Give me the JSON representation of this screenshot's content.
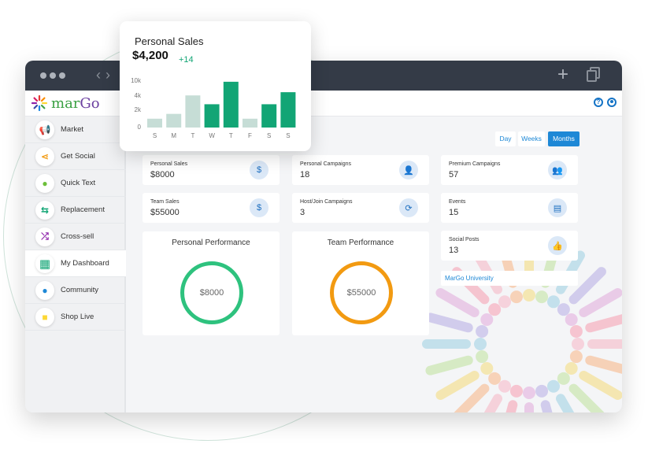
{
  "sales_card": {
    "title": "Personal Sales",
    "value": "$4,200",
    "delta": "+14",
    "chart_data": {
      "type": "bar",
      "categories": [
        "S",
        "M",
        "T",
        "W",
        "T",
        "F",
        "S",
        "S"
      ],
      "values": [
        1.1,
        1.7,
        4.0,
        2.9,
        5.7,
        1.1,
        2.9,
        4.4
      ],
      "yticks": [
        "0",
        "2k",
        "4k",
        "10k"
      ],
      "colors": [
        "#c6ddd6",
        "#c6ddd6",
        "#c6ddd6",
        "#12a575",
        "#12a575",
        "#c6ddd6",
        "#12a575",
        "#12a575"
      ]
    }
  },
  "brand": {
    "name_a": "mar",
    "name_b": "Go"
  },
  "header": {
    "help": "?"
  },
  "sidebar": {
    "items": [
      {
        "label": "Market",
        "icon": "megaphone-icon",
        "glyph": "📢",
        "active": false
      },
      {
        "label": "Get Social",
        "icon": "share-icon",
        "glyph": "⋖",
        "active": false
      },
      {
        "label": "Quick Text",
        "icon": "chat-icon",
        "glyph": "💬",
        "active": false
      },
      {
        "label": "Replacement",
        "icon": "swap-arrows-icon",
        "glyph": "⇆",
        "active": false
      },
      {
        "label": "Cross-sell",
        "icon": "shuffle-icon",
        "glyph": "⤮",
        "active": false
      },
      {
        "label": "My Dashboard",
        "icon": "dashboard-grid-icon",
        "glyph": "▦",
        "active": true
      },
      {
        "label": "Community",
        "icon": "community-chat-icon",
        "glyph": "💬",
        "active": false
      },
      {
        "label": "Shop Live",
        "icon": "shop-icon",
        "glyph": "🛍",
        "active": false
      }
    ]
  },
  "period": {
    "day": "Day",
    "weeks": "Weeks",
    "months": "Months",
    "selected": "Months"
  },
  "stats": {
    "personal_sales": {
      "label": "Personal Sales",
      "value": "$8000"
    },
    "personal_campaigns": {
      "label": "Personal Campaigns",
      "value": "18"
    },
    "premium_campaigns": {
      "label": "Premium Campaigns",
      "value": "57"
    },
    "team_sales": {
      "label": "Team Sales",
      "value": "$55000"
    },
    "host_join_campaigns": {
      "label": "Host/Join Campaigns",
      "value": "3"
    },
    "events": {
      "label": "Events",
      "value": "15"
    },
    "social_posts": {
      "label": "Social Posts",
      "value": "13"
    }
  },
  "performance": {
    "personal": {
      "title": "Personal Performance",
      "value": "$8000",
      "color": "#2ec27e"
    },
    "team": {
      "title": "Team Performance",
      "value": "$55000",
      "color": "#f29a11"
    }
  },
  "links": {
    "university": "MarGo University"
  }
}
